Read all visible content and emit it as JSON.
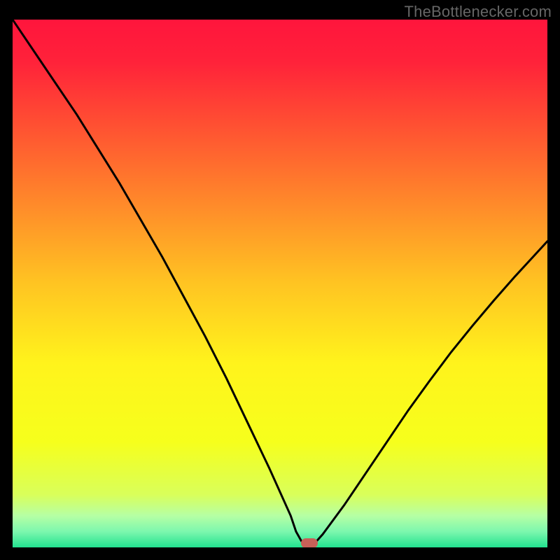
{
  "watermark": {
    "text": "TheBottlenecker.com"
  },
  "chart_data": {
    "type": "line",
    "title": "",
    "xlabel": "",
    "ylabel": "",
    "xlim": [
      0,
      100
    ],
    "ylim": [
      0,
      100
    ],
    "grid": false,
    "background_gradient_vertical": [
      {
        "stop": 0.0,
        "color": "#ff153c"
      },
      {
        "stop": 0.08,
        "color": "#ff223a"
      },
      {
        "stop": 0.2,
        "color": "#ff5032"
      },
      {
        "stop": 0.35,
        "color": "#ff8a2a"
      },
      {
        "stop": 0.5,
        "color": "#ffc422"
      },
      {
        "stop": 0.65,
        "color": "#fff31c"
      },
      {
        "stop": 0.8,
        "color": "#f6ff1c"
      },
      {
        "stop": 0.9,
        "color": "#d9ff5a"
      },
      {
        "stop": 0.94,
        "color": "#b6ffa4"
      },
      {
        "stop": 0.97,
        "color": "#7cf7ae"
      },
      {
        "stop": 1.0,
        "color": "#22e28f"
      }
    ],
    "series": [
      {
        "name": "bottleneck-curve",
        "stroke": "#000000",
        "stroke_width": 3,
        "x": [
          0,
          4,
          8,
          12,
          16,
          20,
          24,
          28,
          32,
          36,
          40,
          44,
          48,
          52,
          53,
          54,
          55,
          56.5,
          58,
          62,
          66,
          70,
          74,
          78,
          82,
          86,
          90,
          94,
          98,
          100
        ],
        "y": [
          100,
          94,
          88,
          82,
          75.5,
          69,
          62,
          55,
          47.5,
          40,
          32,
          23.5,
          15,
          6,
          3,
          1.2,
          0.8,
          0.8,
          2.5,
          8,
          14,
          20,
          26,
          31.6,
          37,
          42,
          46.8,
          51.4,
          55.8,
          58
        ]
      }
    ],
    "marker": {
      "x": 55.5,
      "y": 0.8,
      "color": "#c76058"
    }
  }
}
